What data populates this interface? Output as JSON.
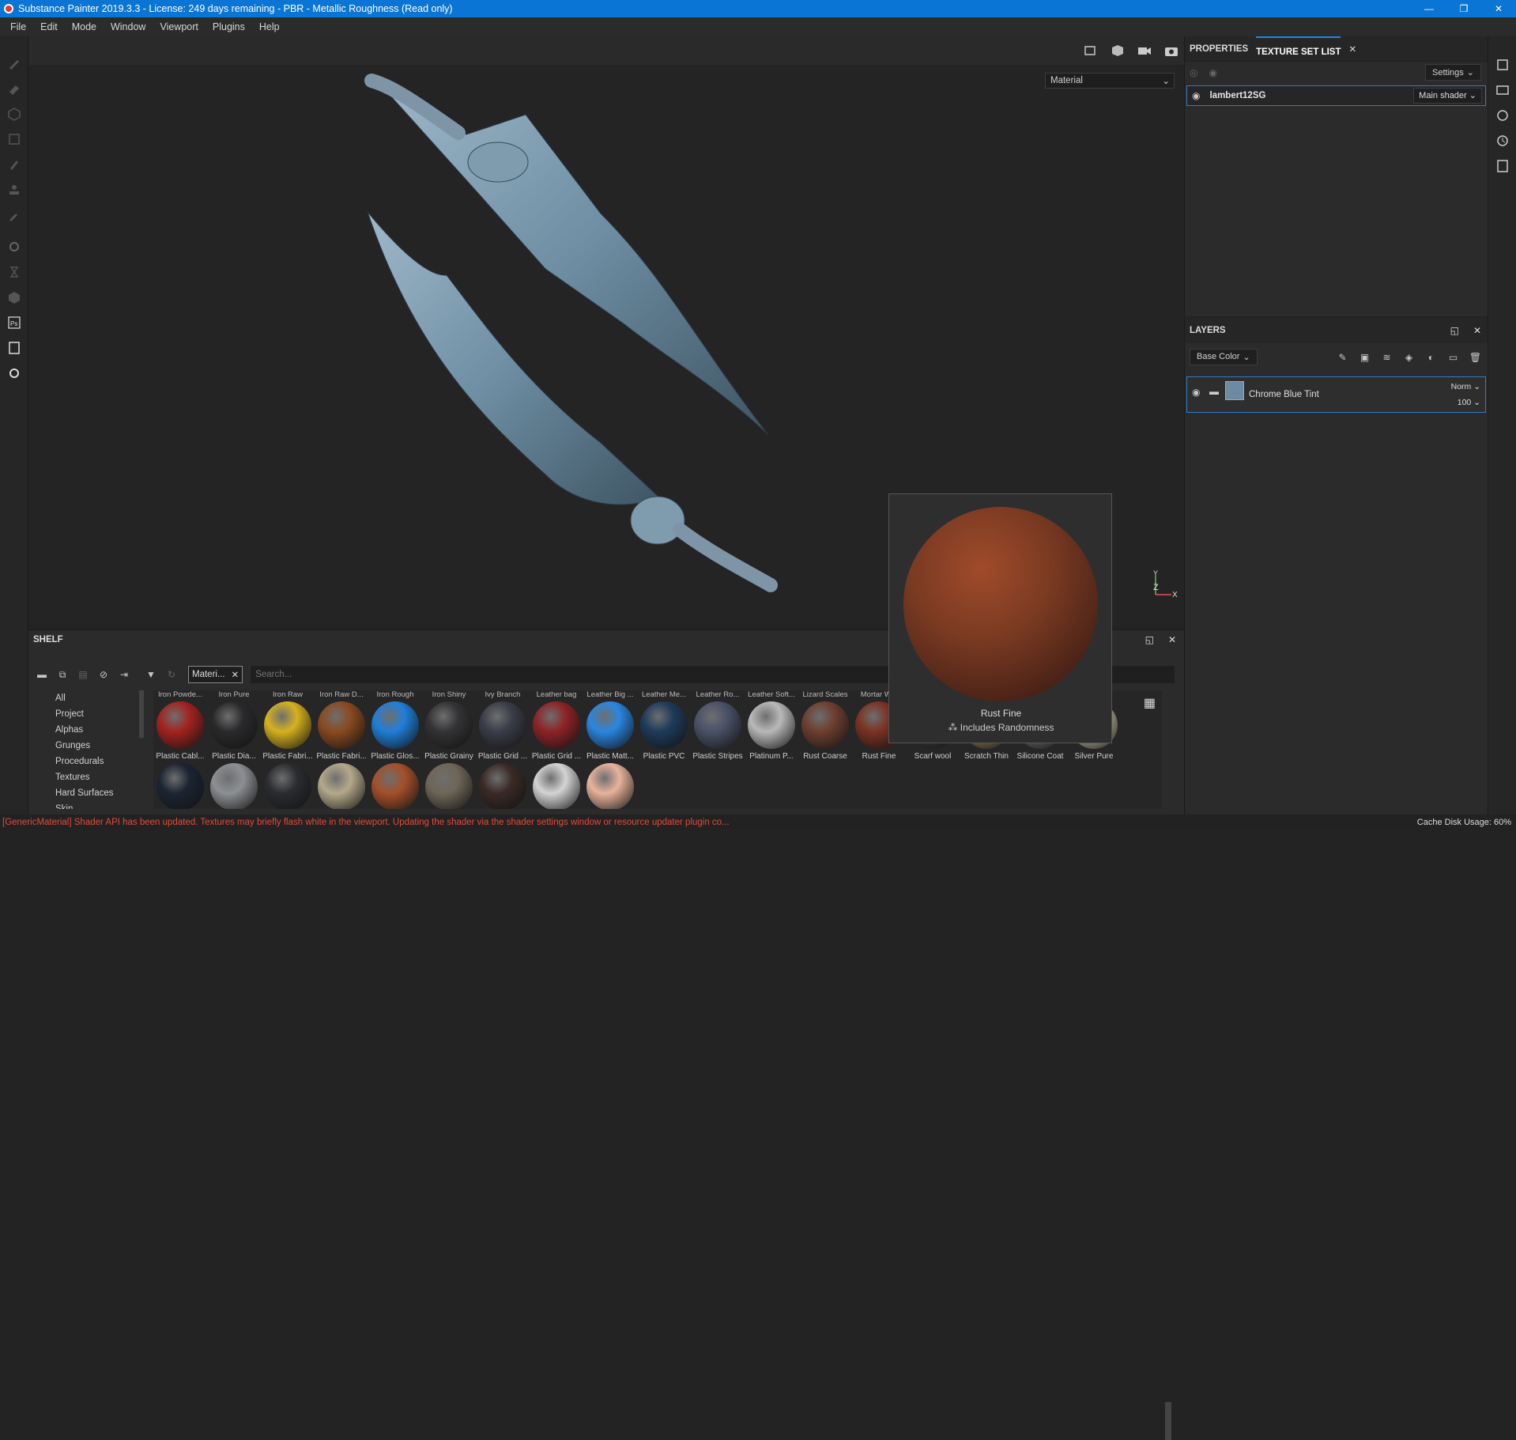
{
  "window": {
    "title": "Substance Painter 2019.3.3 - License: 249 days remaining - PBR - Metallic Roughness (Read only)",
    "minimize": "—",
    "maximize": "❐",
    "close": "✕"
  },
  "menu": [
    "File",
    "Edit",
    "Mode",
    "Window",
    "Viewport",
    "Plugins",
    "Help"
  ],
  "viewport": {
    "channel_dropdown": "Material",
    "axis": {
      "y": "Y",
      "z": "Z",
      "x": "X"
    }
  },
  "properties_panel": {
    "tabs": [
      "PROPERTIES",
      "TEXTURE SET LIST"
    ],
    "active_tab": "TEXTURE SET LIST",
    "settings_label": "Settings",
    "texture_set": {
      "name": "lambert12SG",
      "shader": "Main shader"
    }
  },
  "layers_panel": {
    "title": "LAYERS",
    "channel": "Base Color",
    "layer": {
      "name": "Chrome Blue Tint",
      "blend": "Norm",
      "opacity": "100",
      "color": "#6c8aa1"
    }
  },
  "shelf": {
    "title": "SHELF",
    "filter_tag": "Materi...",
    "search_placeholder": "Search...",
    "categories": [
      "All",
      "Project",
      "Alphas",
      "Grunges",
      "Procedurals",
      "Textures",
      "Hard Surfaces",
      "Skin"
    ],
    "top_row_labels": [
      "Iron Powde...",
      "Iron Pure",
      "Iron Raw",
      "Iron Raw D...",
      "Iron Rough",
      "Iron Shiny",
      "Ivy Branch",
      "Leather bag",
      "Leather Big ...",
      "Leather Me...",
      "Leather Ro...",
      "Leather Soft...",
      "Lizard Scales",
      "Mortar W..."
    ],
    "row1": [
      {
        "name": "Plastic Cabl...",
        "color": "#a3231f"
      },
      {
        "name": "Plastic Dia...",
        "color": "#2a2a2c"
      },
      {
        "name": "Plastic Fabri...",
        "color": "#d6b21f"
      },
      {
        "name": "Plastic Fabri...",
        "color": "#8a4a20"
      },
      {
        "name": "Plastic Glos...",
        "color": "#1f7fd9"
      },
      {
        "name": "Plastic Grainy",
        "color": "#333335"
      },
      {
        "name": "Plastic Grid ...",
        "color": "#3a3d48"
      },
      {
        "name": "Plastic Grid ...",
        "color": "#8e2326"
      },
      {
        "name": "Plastic Matt...",
        "color": "#2a86e0"
      },
      {
        "name": "Plastic PVC",
        "color": "#1d3b5a"
      },
      {
        "name": "Plastic Stripes",
        "color": "#4a5268"
      },
      {
        "name": "Platinum P...",
        "color": "#b9b9b9"
      },
      {
        "name": "Rust Coarse",
        "color": "#6e3e30"
      },
      {
        "name": "Rust Fine",
        "color": "#7a3222"
      },
      {
        "name": "Scarf wool",
        "color": "#3a3a3a"
      },
      {
        "name": "Scratch Thin",
        "color": "#8a7a55"
      },
      {
        "name": "Silicone Coat",
        "color": "#6a6a6a"
      },
      {
        "name": "Silver Pure",
        "color": "#c0b8a0"
      }
    ],
    "row2": [
      {
        "color": "#1c2433"
      },
      {
        "color": "#8c8f93"
      },
      {
        "color": "#2a2c30"
      },
      {
        "color": "#b4a98a"
      },
      {
        "color": "#a4502a"
      },
      {
        "color": "#6e6657"
      },
      {
        "color": "#3a2a26"
      },
      {
        "color": "#d4d4d4"
      },
      {
        "color": "#e8b39c"
      }
    ]
  },
  "preview": {
    "name": "Rust Fine",
    "note": "Includes Randomness"
  },
  "status": {
    "message": "[GenericMaterial] Shader API has been updated. Textures may briefly flash white in the viewport. Updating the shader via the shader settings window or resource updater plugin co...",
    "cache": "Cache Disk Usage:  60%"
  }
}
